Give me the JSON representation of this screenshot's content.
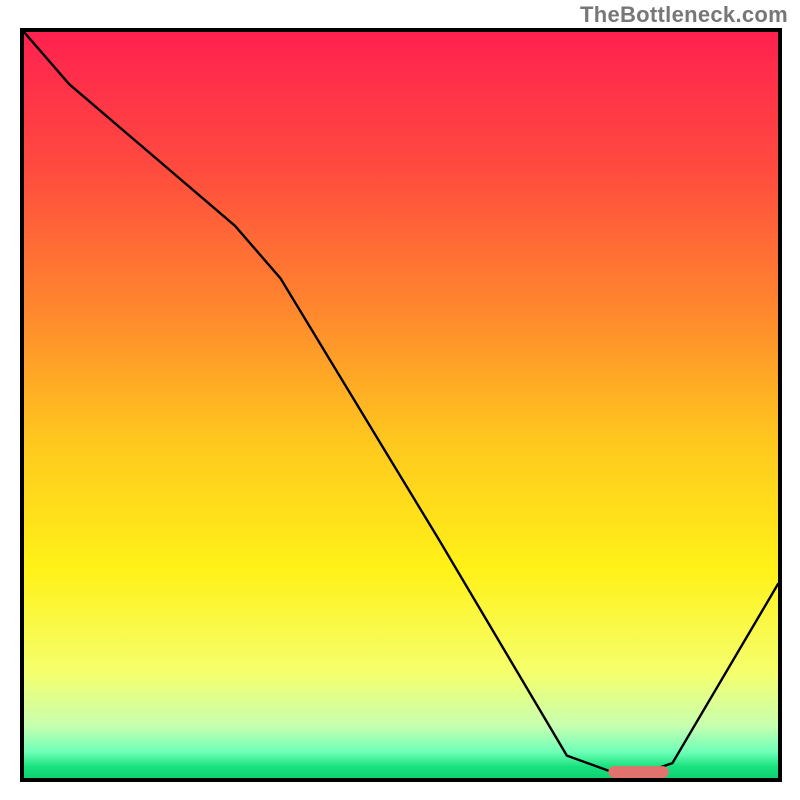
{
  "watermark": "TheBottleneck.com",
  "chart_data": {
    "type": "line",
    "title": "",
    "xlabel": "",
    "ylabel": "",
    "xlim": [
      0,
      100
    ],
    "ylim": [
      0,
      100
    ],
    "background_gradient": {
      "stops": [
        {
          "pos": 0.0,
          "color": "#ff214f"
        },
        {
          "pos": 0.18,
          "color": "#ff4a3f"
        },
        {
          "pos": 0.38,
          "color": "#ff8a2d"
        },
        {
          "pos": 0.55,
          "color": "#ffc81e"
        },
        {
          "pos": 0.72,
          "color": "#fff218"
        },
        {
          "pos": 0.86,
          "color": "#f5ff6e"
        },
        {
          "pos": 0.93,
          "color": "#c7ffb0"
        },
        {
          "pos": 0.965,
          "color": "#6fffb8"
        },
        {
          "pos": 0.985,
          "color": "#18e27e"
        },
        {
          "pos": 1.0,
          "color": "#0fd173"
        }
      ]
    },
    "series": [
      {
        "name": "bottleneck-curve",
        "color": "#000000",
        "width": 2.4,
        "x": [
          0,
          6,
          28,
          34,
          55,
          72,
          78,
          82,
          86,
          100
        ],
        "y": [
          100,
          93,
          74,
          67,
          32,
          3,
          0.8,
          0.6,
          2,
          26
        ]
      }
    ],
    "marker": {
      "name": "optimal-range",
      "color": "#e2726e",
      "x_start": 77.5,
      "x_end": 85.5,
      "y": 0.8,
      "thickness_pct": 1.6
    }
  }
}
